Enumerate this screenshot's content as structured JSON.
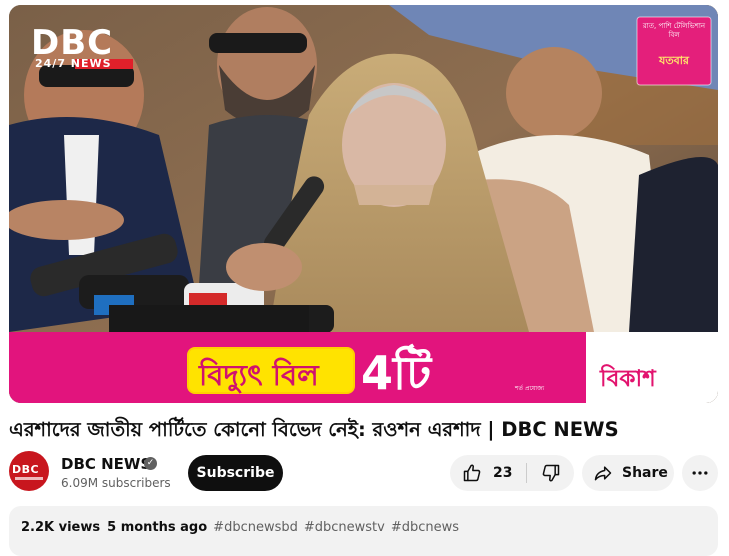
{
  "video": {
    "logo": {
      "main": "DBC",
      "sub": "24/7 NEWS"
    },
    "promo_badge": {
      "lines": "রাত, পাশি টেলিভিশান বিল",
      "day": "যতবার"
    },
    "banner": {
      "bill_text": "বিদ্যুৎ বিল",
      "count_text": "4টি",
      "brand": "বিকাশ",
      "note": "শর্ত প্রযোজ্য",
      "colors": {
        "pink": "#e2147d",
        "yellow": "#ffe300"
      }
    }
  },
  "title": "এরশাদের জাতীয় পার্টিতে কোনো বিভেদ নেই: রওশন এরশাদ | DBC NEWS",
  "channel": {
    "avatar_text": "DBC",
    "name": "DBC NEWS",
    "subscribers": "6.09M subscribers",
    "verified_icon": "check-circle-icon"
  },
  "actions": {
    "subscribe_label": "Subscribe",
    "like_count": "23",
    "like_icon": "thumbs-up-icon",
    "dislike_icon": "thumbs-down-icon",
    "share_label": "Share",
    "share_icon": "share-arrow-icon",
    "more_icon": "more-horizontal-icon"
  },
  "description": {
    "views": "2.2K views",
    "upload_date": "5 months ago",
    "hashtags": [
      "#dbcnewsbd",
      "#dbcnewstv",
      "#dbcnews"
    ]
  }
}
